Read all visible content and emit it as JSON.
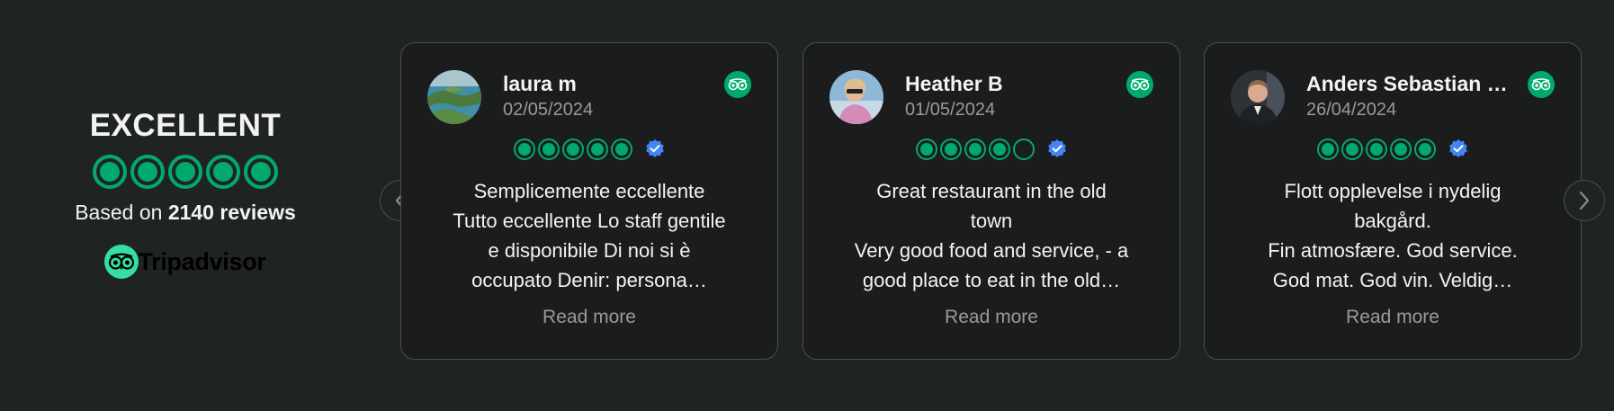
{
  "summary": {
    "title": "EXCELLENT",
    "rating_bubbles": 5,
    "based_prefix": "Based on",
    "review_count": "2140 reviews",
    "logo_text": "Tripadvisor"
  },
  "colors": {
    "background": "#202324",
    "card_background": "#1b1c1d",
    "card_border": "#4a4d50",
    "bubble_green": "#00aa6c",
    "logo_green": "#34e0a1",
    "verified_blue": "#4285f4",
    "muted_text": "#9a9a9a"
  },
  "reviews": [
    {
      "name": "laura m",
      "date": "02/05/2024",
      "rating": 5,
      "verified": true,
      "avatar": "landscape-photo",
      "lines": [
        "Semplicemente eccellente",
        "Tutto eccellente Lo staff gentile",
        "e disponibile Di noi si è",
        "occupato Denir: persona…"
      ],
      "read_more": "Read more"
    },
    {
      "name": "Heather B",
      "date": "01/05/2024",
      "rating": 4,
      "verified": true,
      "avatar": "person-photo",
      "lines": [
        "Great restaurant in the old",
        "town",
        "Very good food and service, - a",
        "good place to eat in the old…"
      ],
      "read_more": "Read more"
    },
    {
      "name": "Anders Sebastian …",
      "date": "26/04/2024",
      "rating": 5,
      "verified": true,
      "avatar": "person-photo",
      "lines": [
        "Flott opplevelse i nydelig",
        "bakgård.",
        "Fin atmosfære. God service.",
        "God mat. God vin. Veldig…"
      ],
      "read_more": "Read more"
    }
  ],
  "navigation": {
    "prev_icon": "chevron-left-icon",
    "next_icon": "chevron-right-icon"
  }
}
